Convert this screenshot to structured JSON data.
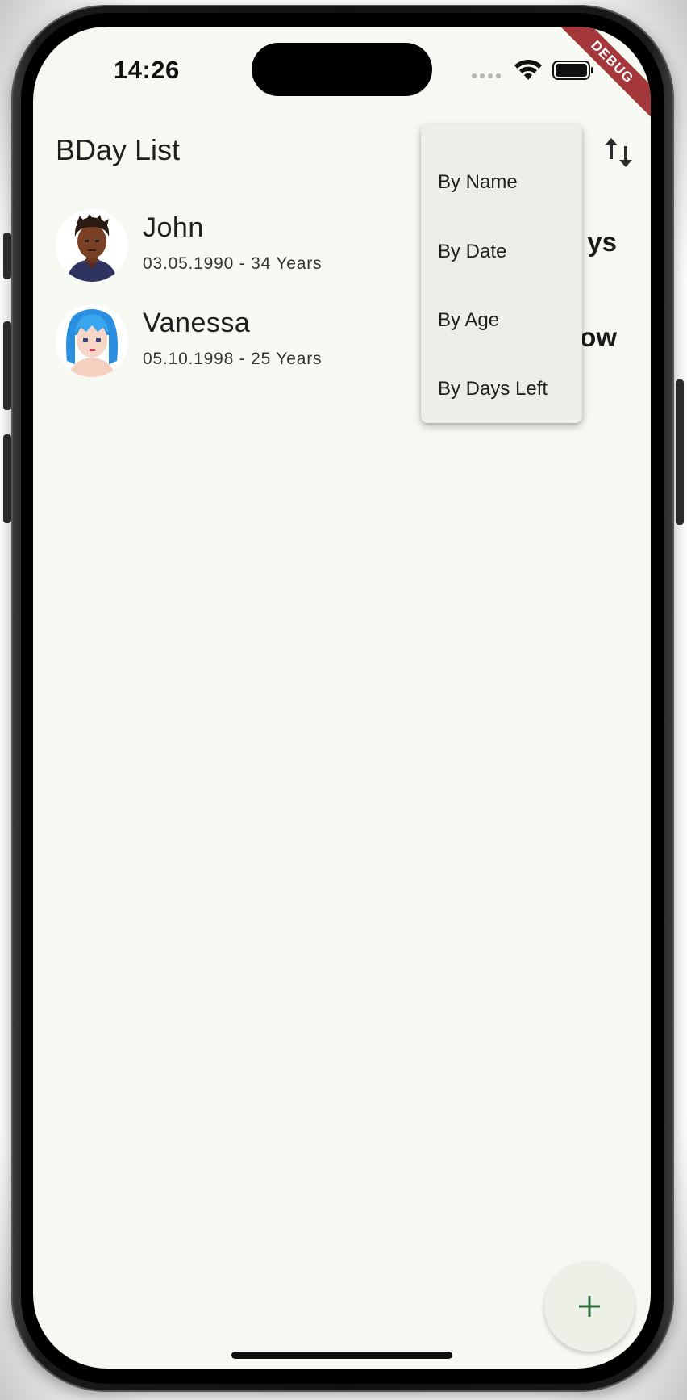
{
  "status_bar": {
    "time": "14:26",
    "debug_label": "DEBUG"
  },
  "app_bar": {
    "title": "BDay List",
    "sort_icon": "swap-vertical-icon"
  },
  "people": [
    {
      "name": "John",
      "details": "03.05.1990 - 34 Years",
      "trailing": "ys",
      "avatar": "avatar-john"
    },
    {
      "name": "Vanessa",
      "details": "05.10.1998 - 25 Years",
      "trailing": "ow",
      "avatar": "avatar-vanessa"
    }
  ],
  "sort_menu": {
    "items": [
      "By Name",
      "By Date",
      "By Age",
      "By Days Left"
    ]
  },
  "fab": {
    "icon": "plus-icon"
  },
  "colors": {
    "background": "#f6f9f1",
    "menu": "#ecefe8",
    "fab_icon": "#2e6b3a",
    "debug_banner": "#a3373a"
  }
}
